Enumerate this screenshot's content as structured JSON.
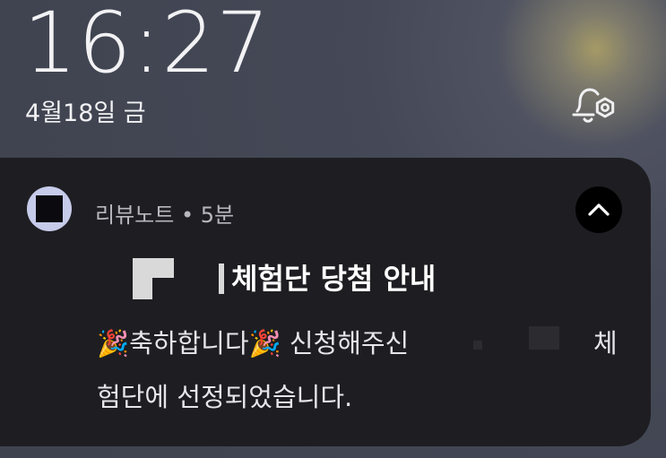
{
  "lockscreen": {
    "time": "16:27",
    "date": "4월18일 금"
  },
  "notification": {
    "app_name": "리뷰노트",
    "separator": " • ",
    "time_ago": "5분",
    "title": "체험단 당첨 안내",
    "body_line1": "🎉축하합니다🎉 신청해주신",
    "body_line1_trail": "체",
    "body_line2": "험단에 선정되었습니다."
  },
  "icons": {
    "settings": "notification-settings-icon",
    "collapse": "chevron-up-icon",
    "app": "app-icon"
  },
  "colors": {
    "card_bg": "#1e1e22",
    "app_icon_bg": "#c6cbea"
  }
}
